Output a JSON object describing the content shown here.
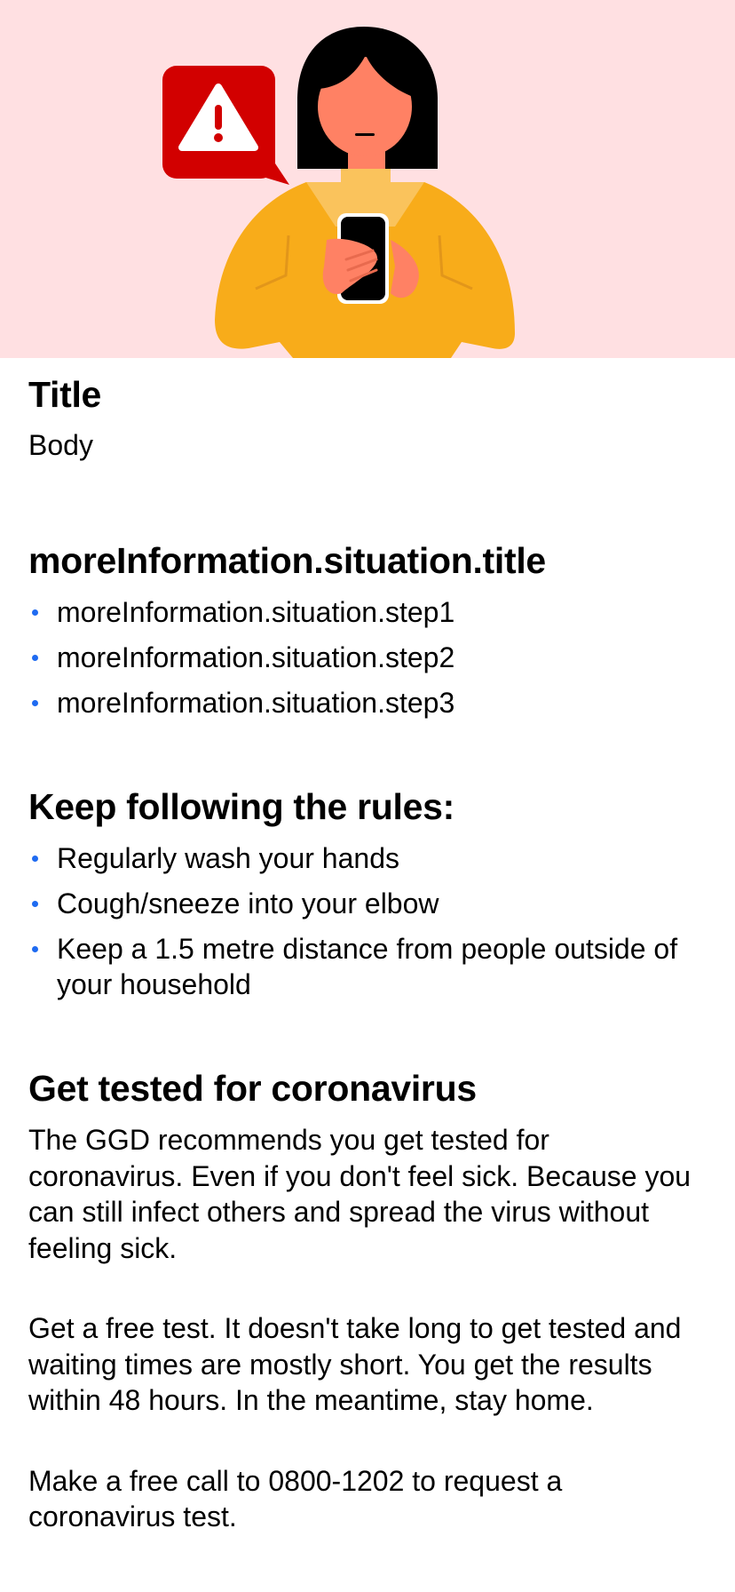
{
  "intro": {
    "title": "Title",
    "body": "Body"
  },
  "situation": {
    "title": "moreInformation.situation.title",
    "steps": [
      "moreInformation.situation.step1",
      "moreInformation.situation.step2",
      "moreInformation.situation.step3"
    ]
  },
  "rules": {
    "title": "Keep following the rules:",
    "items": [
      "Regularly wash your hands",
      "Cough/sneeze into your elbow",
      "Keep a 1.5 metre distance from people outside of your household"
    ]
  },
  "testing": {
    "title": "Get tested for coronavirus",
    "paragraphs": [
      "The GGD recommends you get tested for coronavirus. Even if you don't feel sick. Because you can still infect others and spread the virus without feeling sick.",
      "Get a free test. It doesn't take long to get tested and waiting times are mostly short. You get the results within 48 hours. In the meantime, stay home.",
      "Make a free call to 0800-1202 to request a coronavirus test."
    ]
  },
  "colors": {
    "hero_background": "#FFE0E2",
    "bullet": "#1F6BF1",
    "warning_red": "#D20000",
    "sweater": "#F8AC1A"
  },
  "icons": [
    "warning-icon",
    "person-with-phone-illustration"
  ]
}
